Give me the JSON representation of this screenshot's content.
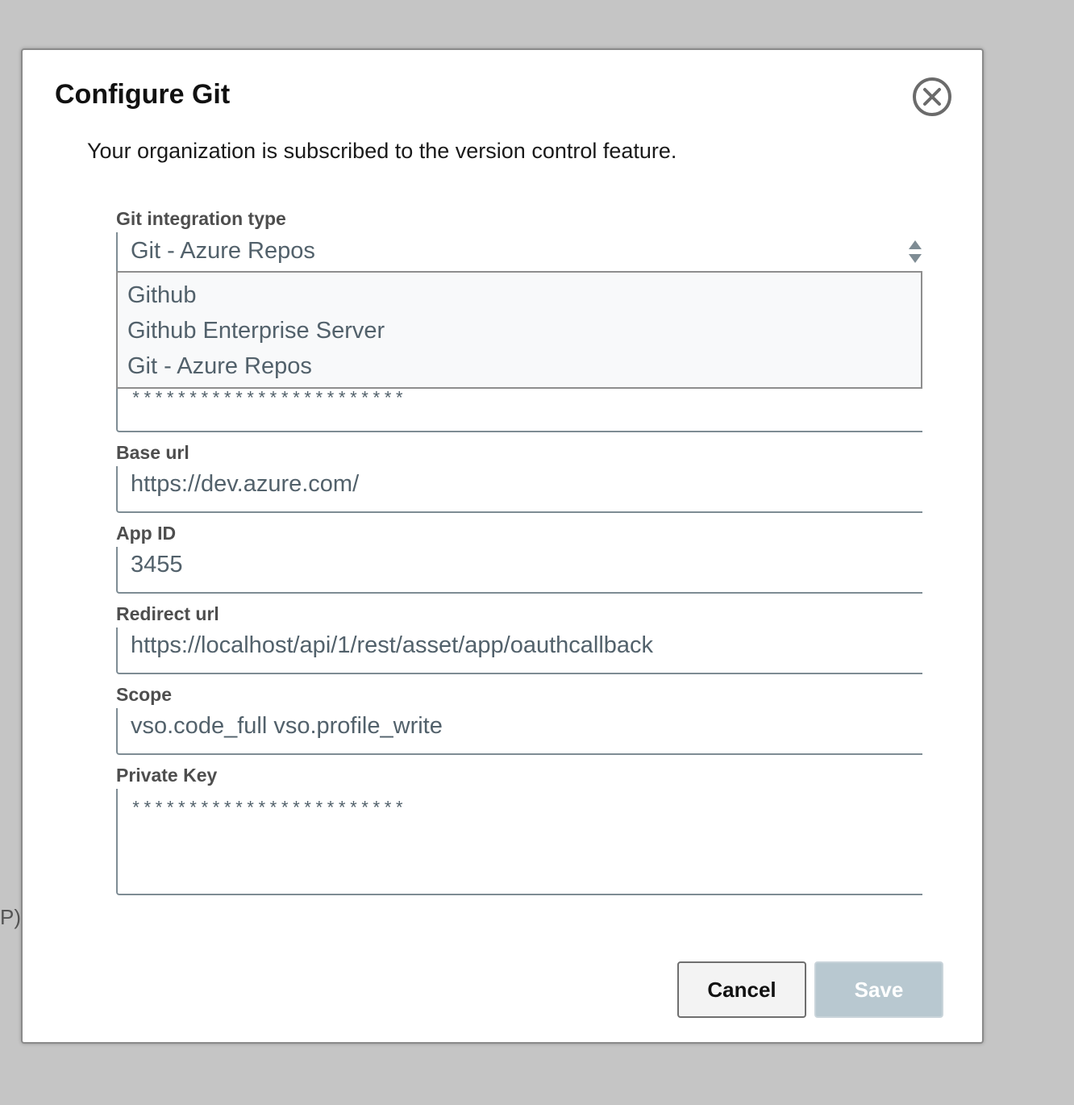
{
  "background": {
    "fragment_text": "P)"
  },
  "dialog": {
    "title": "Configure Git",
    "subtitle": "Your organization is subscribed to the version control feature.",
    "close_icon": "close-circle-icon"
  },
  "integration_type": {
    "label": "Git integration type",
    "selected": "Git - Azure Repos",
    "options": [
      "Github",
      "Github Enterprise Server",
      "Git - Azure Repos"
    ]
  },
  "hidden_field": {
    "value": "************************"
  },
  "fields": {
    "base_url": {
      "label": "Base url",
      "value": "https://dev.azure.com/"
    },
    "app_id": {
      "label": "App ID",
      "value": "3455"
    },
    "redirect_url": {
      "label": "Redirect url",
      "value": "https://localhost/api/1/rest/asset/app/oauthcallback"
    },
    "scope": {
      "label": "Scope",
      "value": "vso.code_full vso.profile_write"
    },
    "private_key": {
      "label": "Private Key",
      "value": "************************"
    }
  },
  "buttons": {
    "cancel": "Cancel",
    "save": "Save"
  },
  "colors": {
    "save_disabled": "#b8c8d0",
    "field_text": "#52616b"
  }
}
